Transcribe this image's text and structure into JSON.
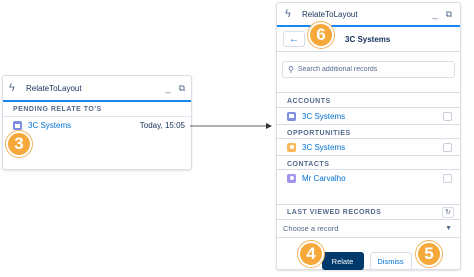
{
  "left_panel": {
    "title": "RelateToLayout",
    "section": "PENDING RELATE TO'S",
    "record": {
      "name": "3C Systems",
      "time": "Today, 15:05"
    }
  },
  "right_panel": {
    "title": "RelateToLayout",
    "subtitle": "3C Systems",
    "search_placeholder": "Search additional records",
    "sections": [
      {
        "label": "ACCOUNTS",
        "record": "3C Systems"
      },
      {
        "label": "OPPORTUNITIES",
        "record": "3C Systems"
      },
      {
        "label": "CONTACTS",
        "record": "Mr Carvalho"
      }
    ],
    "last_viewed": "LAST VIEWED RECORDS",
    "choose_placeholder": "Choose a record",
    "relate_label": "Relate",
    "dismiss_label": "Dismiss"
  },
  "icons": {
    "bolt": "lightning-icon",
    "minimize": "minimize-icon",
    "popout": "popout-icon",
    "back": "back-arrow-icon",
    "search": "search-icon",
    "refresh": "refresh-icon",
    "caret": "chevron-down-icon"
  },
  "colors": {
    "accent": "#1589ee",
    "badge": "#f6a83b",
    "primary_button": "#00396b",
    "link": "#0070d2"
  },
  "badges": {
    "three": "3",
    "four": "4",
    "five": "5",
    "six": "6"
  }
}
